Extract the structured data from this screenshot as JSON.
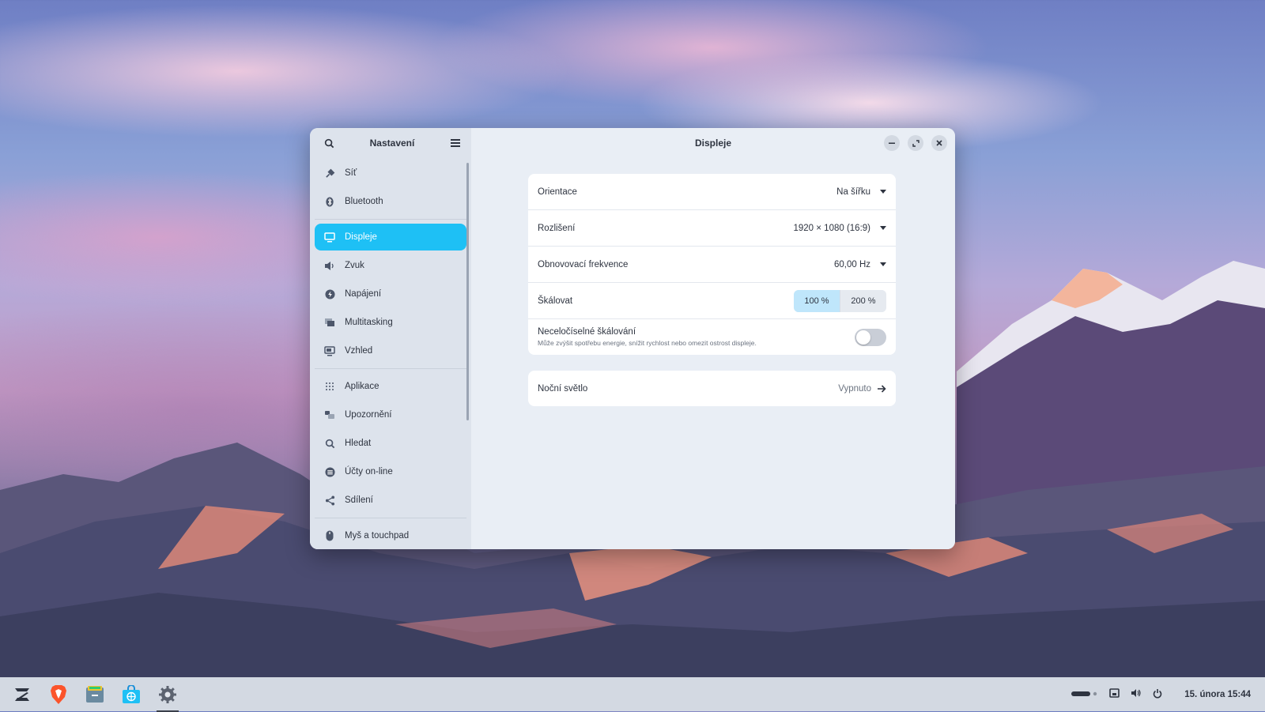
{
  "window": {
    "sidebar_title": "Nastavení",
    "page_title": "Displeje"
  },
  "sidebar": {
    "items": [
      {
        "label": "Síť",
        "icon": "network-icon"
      },
      {
        "label": "Bluetooth",
        "icon": "bluetooth-icon"
      },
      {
        "label": "Displeje",
        "icon": "display-icon",
        "active": true
      },
      {
        "label": "Zvuk",
        "icon": "speaker-icon"
      },
      {
        "label": "Napájení",
        "icon": "power-icon"
      },
      {
        "label": "Multitasking",
        "icon": "multitasking-icon"
      },
      {
        "label": "Vzhled",
        "icon": "appearance-icon"
      },
      {
        "label": "Aplikace",
        "icon": "apps-grid-icon"
      },
      {
        "label": "Upozornění",
        "icon": "notifications-icon"
      },
      {
        "label": "Hledat",
        "icon": "search-icon"
      },
      {
        "label": "Účty on-line",
        "icon": "online-accounts-icon"
      },
      {
        "label": "Sdílení",
        "icon": "share-icon"
      },
      {
        "label": "Myš a touchpad",
        "icon": "mouse-icon"
      }
    ]
  },
  "display": {
    "orientation_label": "Orientace",
    "orientation_value": "Na šířku",
    "resolution_label": "Rozlišení",
    "resolution_value": "1920 × 1080 (16:9)",
    "refresh_label": "Obnovovací frekvence",
    "refresh_value": "60,00 Hz",
    "scale_label": "Škálovat",
    "scale_options": [
      "100 %",
      "200 %"
    ],
    "scale_selected": "100 %",
    "fractional_label": "Neceločíselné škálování",
    "fractional_desc": "Může zvýšit spotřebu energie, snížit rychlost nebo omezit ostrost displeje.",
    "fractional_enabled": false,
    "night_light_label": "Noční světlo",
    "night_light_value": "Vypnuto"
  },
  "taskbar": {
    "apps": [
      "zorin-menu-icon",
      "brave-browser-icon",
      "files-icon",
      "software-store-icon",
      "settings-gear-icon"
    ],
    "clock": "15. února 15:44"
  },
  "colors": {
    "accent": "#1ec0f5",
    "window_bg": "#e9eef5",
    "sidebar_bg": "#dde3ec"
  }
}
